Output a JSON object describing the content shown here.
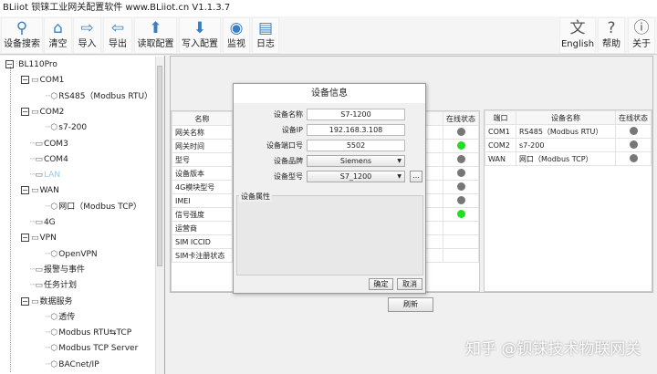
{
  "title": "BLiiot  钡铼工业网关配置软件 www.BLiiot.cn V1.1.3.7",
  "toolbar": {
    "left": [
      {
        "label": "设备搜索",
        "icon": "search-icon"
      },
      {
        "label": "清空",
        "icon": "brush-icon"
      },
      {
        "label": "导入",
        "icon": "import-icon"
      },
      {
        "label": "导出",
        "icon": "export-icon"
      },
      {
        "label": "读取配置",
        "icon": "upload-icon"
      },
      {
        "label": "写入配置",
        "icon": "download-icon"
      },
      {
        "label": "监视",
        "icon": "eye-icon"
      },
      {
        "label": "日志",
        "icon": "log-icon"
      }
    ],
    "right": [
      {
        "label": "English",
        "icon": "language-icon"
      },
      {
        "label": "帮助",
        "icon": "help-icon"
      },
      {
        "label": "关于",
        "icon": "info-icon"
      }
    ]
  },
  "tree": [
    {
      "label": "BL110Pro",
      "level": 0,
      "exp": true
    },
    {
      "label": "COM1",
      "level": 1,
      "exp": true
    },
    {
      "label": "RS485（Modbus RTU）",
      "level": 2
    },
    {
      "label": "COM2",
      "level": 1,
      "exp": true
    },
    {
      "label": "s7-200",
      "level": 2
    },
    {
      "label": "COM3",
      "level": 1
    },
    {
      "label": "COM4",
      "level": 1
    },
    {
      "label": "LAN",
      "level": 1,
      "disabled": true
    },
    {
      "label": "WAN",
      "level": 1,
      "exp": true
    },
    {
      "label": "网口（Modbus TCP）",
      "level": 2
    },
    {
      "label": "4G",
      "level": 1
    },
    {
      "label": "VPN",
      "level": 1,
      "exp": true
    },
    {
      "label": "OpenVPN",
      "level": 2
    },
    {
      "label": "报警与事件",
      "level": 1
    },
    {
      "label": "任务计划",
      "level": 1
    },
    {
      "label": "数据服务",
      "level": 1,
      "exp": true
    },
    {
      "label": "透传",
      "level": 2
    },
    {
      "label": "Modbus RTU⇆TCP",
      "level": 2
    },
    {
      "label": "Modbus TCP Server",
      "level": 2
    },
    {
      "label": "BACnet/IP",
      "level": 2
    }
  ],
  "left_table": {
    "headers": [
      "名称",
      "在线状态"
    ],
    "rows": [
      {
        "name": "网关名称",
        "online": false
      },
      {
        "name": "网关时间",
        "online": true
      },
      {
        "name": "型号",
        "online": false
      },
      {
        "name": "设备版本",
        "online": false
      },
      {
        "name": "4G模块型号",
        "online": false
      },
      {
        "name": "IMEI",
        "online": false
      },
      {
        "name": "信号强度",
        "online": true
      },
      {
        "name": "运营商"
      },
      {
        "name": "SIM ICCID"
      },
      {
        "name": "SIM卡注册状态"
      }
    ]
  },
  "right_table": {
    "headers": [
      "端口",
      "设备名称",
      "在线状态"
    ],
    "rows": [
      {
        "port": "COM1",
        "device": "RS485（Modbus RTU）",
        "online": false
      },
      {
        "port": "COM2",
        "device": "s7-200",
        "online": false
      },
      {
        "port": "WAN",
        "device": "网口（Modbus TCP）",
        "online": false
      }
    ]
  },
  "refresh_label": "刷新",
  "dialog": {
    "title": "设备信息",
    "name_label": "设备名称",
    "name_value": "S7-1200",
    "ip_label": "设备IP",
    "ip_value": "192.168.3.108",
    "port_label": "设备端口号",
    "port_value": "5502",
    "brand_label": "设备品牌",
    "brand_value": "Siemens",
    "model_label": "设备型号",
    "model_value": "S7_1200",
    "more_label": "...",
    "group_label": "设备属性",
    "ok": "确定",
    "cancel": "取消"
  },
  "watermark": "知乎 @钡铼技术物联网关"
}
